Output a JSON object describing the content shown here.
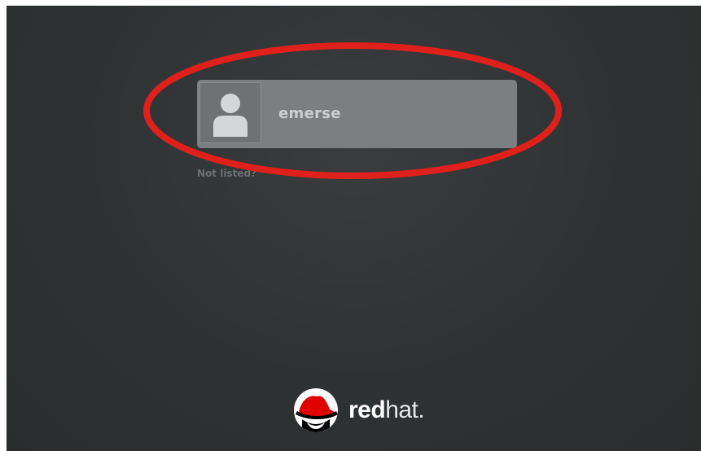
{
  "login": {
    "user": {
      "name": "emerse",
      "avatar_icon": "default-user-silhouette-icon"
    },
    "not_listed_label": "Not listed?"
  },
  "branding": {
    "logo_icon": "redhat-shadowman-icon",
    "wordmark_bold": "red",
    "wordmark_light": "hat",
    "wordmark_suffix": "."
  },
  "annotation": {
    "shape": "ellipse",
    "color": "#e0201a"
  },
  "colors": {
    "background": "#2f3233",
    "user_row": "#7b7f81",
    "logo_red": "#e00000"
  }
}
